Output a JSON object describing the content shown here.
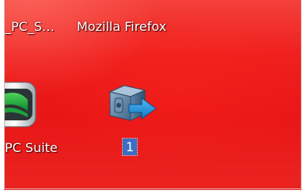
{
  "desktop": {
    "background_color": "#e81616",
    "icons": {
      "pc_sync": {
        "label": "_PC_S…",
        "icon": "pc-sync-shortcut"
      },
      "firefox": {
        "label": "Mozilla Firefox",
        "icon": "firefox-shortcut"
      },
      "pc_suite": {
        "label": "PC Suite",
        "icon": "pc-suite-icon"
      },
      "new_item": {
        "label": "1",
        "icon": "blue-cube-shortcut-icon",
        "selected": true,
        "selection_color": "#3a6fc4"
      }
    }
  }
}
